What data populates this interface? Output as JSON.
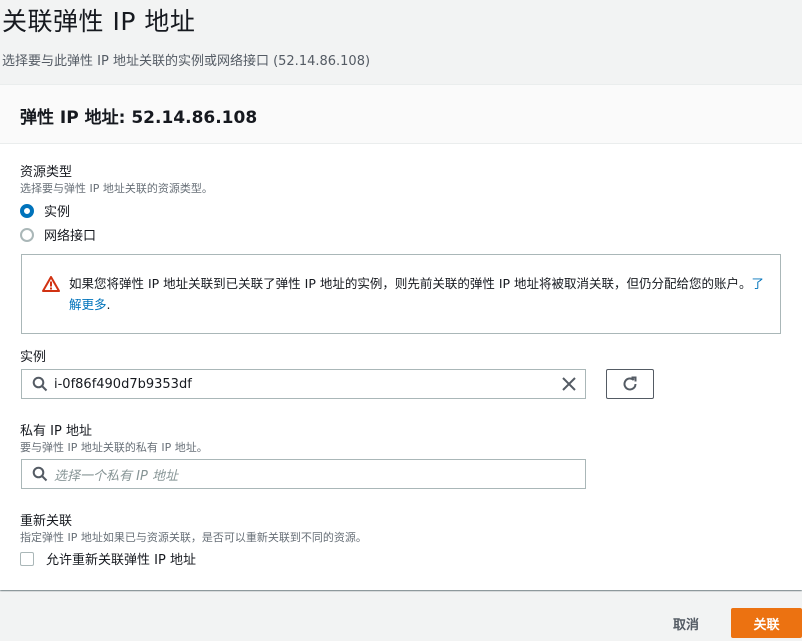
{
  "page": {
    "title": "关联弹性 IP 地址",
    "description": "选择要与此弹性 IP 地址关联的实例或网络接口 (52.14.86.108)"
  },
  "panel": {
    "title": "弹性 IP 地址: 52.14.86.108"
  },
  "resource_type": {
    "label": "资源类型",
    "description": "选择要与弹性 IP 地址关联的资源类型。",
    "options": [
      {
        "label": "实例",
        "selected": true
      },
      {
        "label": "网络接口",
        "selected": false
      }
    ]
  },
  "alert": {
    "icon": "warning-icon",
    "text": "如果您将弹性 IP 地址关联到已关联了弹性 IP 地址的实例，则先前关联的弹性 IP 地址将被取消关联，但仍分配给您的账户。",
    "link_label": "了解更多",
    "suffix": "."
  },
  "instance": {
    "label": "实例",
    "value": "i-0f86f490d7b9353df"
  },
  "private_ip": {
    "label": "私有 IP 地址",
    "description": "要与弹性 IP 地址关联的私有 IP 地址。",
    "placeholder": "选择一个私有 IP 地址"
  },
  "reassociation": {
    "label": "重新关联",
    "description": "指定弹性 IP 地址如果已与资源关联，是否可以重新关联到不同的资源。",
    "checkbox_label": "允许重新关联弹性 IP 地址",
    "checked": false
  },
  "footer": {
    "cancel_label": "取消",
    "associate_label": "关联"
  },
  "colors": {
    "primary": "#ec7211",
    "link": "#0073bb",
    "warning": "#d13212"
  }
}
